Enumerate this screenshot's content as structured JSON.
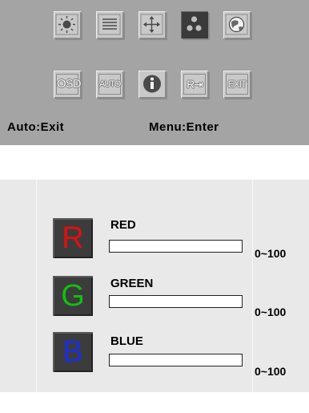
{
  "menu": {
    "row1": [
      {
        "icon": "brightness-sun-icon"
      },
      {
        "icon": "lines-image-icon"
      },
      {
        "icon": "position-arrows-icon"
      },
      {
        "icon": "color-dots-icon",
        "selected": true
      },
      {
        "icon": "globe-language-icon"
      }
    ],
    "row2": [
      {
        "icon": "osd-icon",
        "label": "OSD"
      },
      {
        "icon": "auto-icon",
        "label": "AUTO"
      },
      {
        "icon": "info-icon",
        "label": "i"
      },
      {
        "icon": "input-source-icon",
        "label": "R⇥"
      },
      {
        "icon": "exit-icon",
        "label": "EXIT"
      }
    ],
    "hint_left": "Auto:Exit",
    "hint_right": "Menu:Enter"
  },
  "channels": [
    {
      "letter": "R",
      "label": "RED",
      "range": "0~100",
      "color": "#e01010",
      "value": 0
    },
    {
      "letter": "G",
      "label": "GREEN",
      "range": "0~100",
      "color": "#10c010",
      "value": 0
    },
    {
      "letter": "B",
      "label": "BLUE",
      "range": "0~100",
      "color": "#1a2ee0",
      "value": 0
    }
  ]
}
